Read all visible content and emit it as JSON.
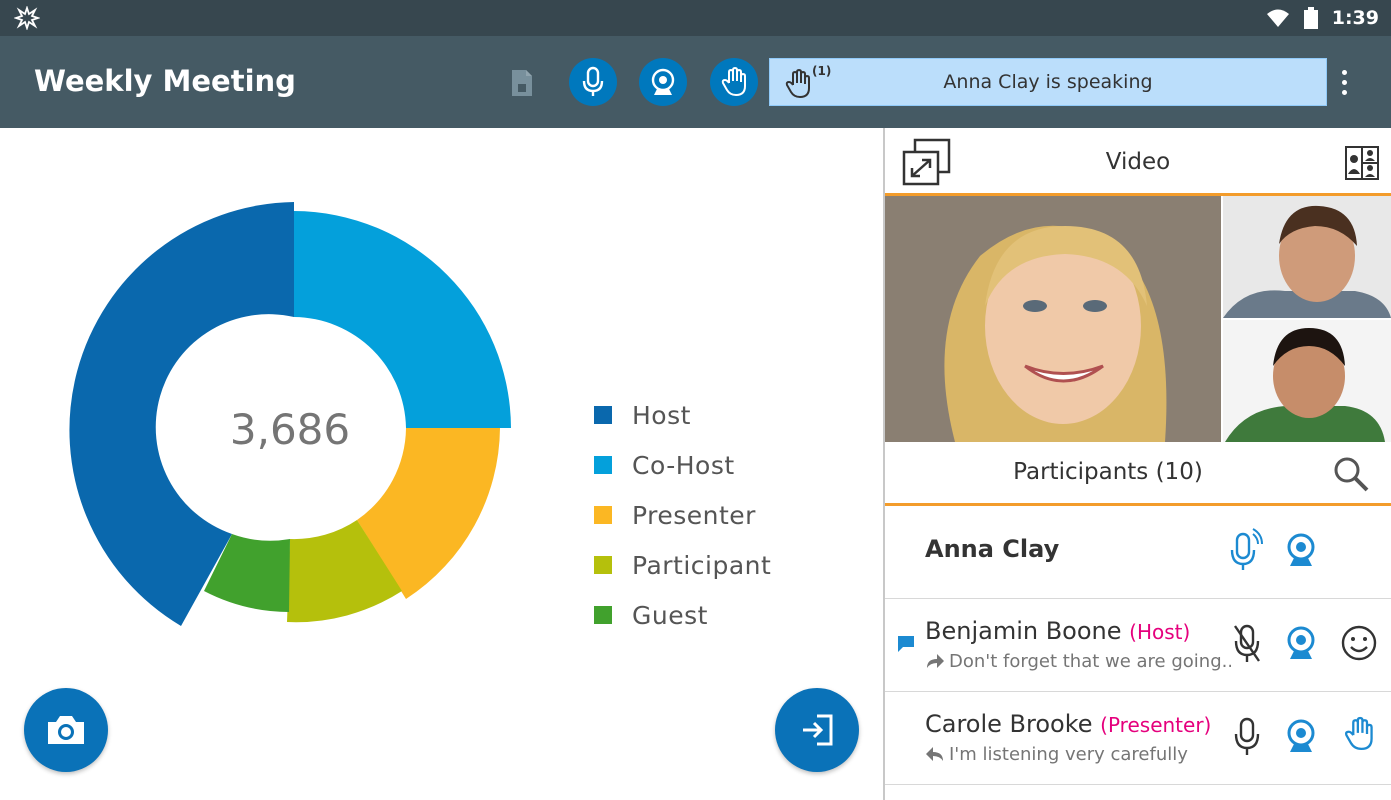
{
  "status_bar": {
    "time": "1:39"
  },
  "header": {
    "title": "Weekly Meeting",
    "speaking_banner": {
      "raised_hands_count": "(1)",
      "text": "Anna Clay is speaking"
    }
  },
  "chart_data": {
    "type": "pie",
    "center_label": "3,686",
    "legend": [
      "Host",
      "Co-Host",
      "Presenter",
      "Participant",
      "Guest"
    ],
    "colors": {
      "Host": "#0a68ad",
      "Co-Host": "#04a0db",
      "Presenter": "#fbb723",
      "Participant": "#b5c00c",
      "Guest": "#41a12d"
    }
  },
  "video_panel": {
    "title": "Video"
  },
  "participants": {
    "title": "Participants (10)",
    "rows": [
      {
        "name": "Anna Clay",
        "role": "",
        "message": ""
      },
      {
        "name": "Benjamin Boone",
        "role": "(Host)",
        "message": "Don't  forget that we are going..."
      },
      {
        "name": "Carole Brooke",
        "role": "(Presenter)",
        "message": "I'm listening very carefully"
      }
    ]
  }
}
